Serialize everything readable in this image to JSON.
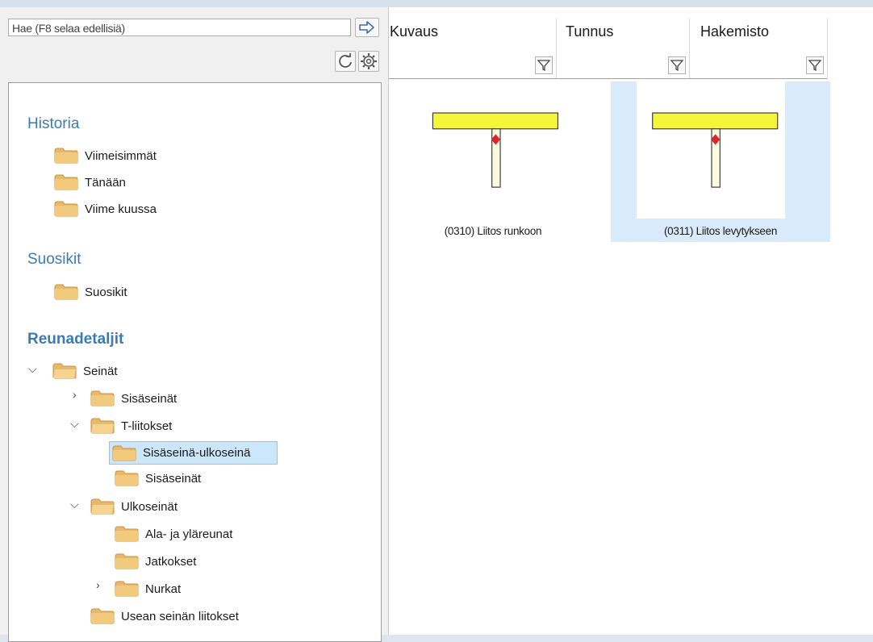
{
  "search": {
    "placeholder": "Hae (F8 selaa edellisiä)"
  },
  "colors": {
    "accent": "#3d7ab5",
    "selection": "#cce6fa",
    "folder": "#e8b96a",
    "beam": "#f5f53a",
    "joint": "#e0222a"
  },
  "tree": {
    "sections": [
      {
        "title": "Historia",
        "items": [
          "Viimeisimmät",
          "Tänään",
          "Viime kuussa"
        ]
      },
      {
        "title": "Suosikit",
        "items": [
          "Suosikit"
        ]
      },
      {
        "title": "Reunadetaljit"
      }
    ],
    "reuna": {
      "seinat": "Seinät",
      "sisaseinat": "Sisäseinät",
      "tliitokset": "T-liitokset",
      "sisa_ulko": "Sisäseinä-ulkoseinä",
      "t_sisaseinat": "Sisäseinät",
      "ulkoseinat": "Ulkoseinät",
      "ala_ylareunat": "Ala- ja yläreunat",
      "jatkokset": "Jatkokset",
      "nurkat": "Nurkat",
      "usean": "Usean seinän liitokset"
    }
  },
  "columns": [
    "Kuvaus",
    "Tunnus",
    "Hakemisto"
  ],
  "results": [
    {
      "caption": "(0310) Liitos runkoon",
      "selected": false
    },
    {
      "caption": "(0311) Liitos levytykseen",
      "selected": true
    }
  ]
}
